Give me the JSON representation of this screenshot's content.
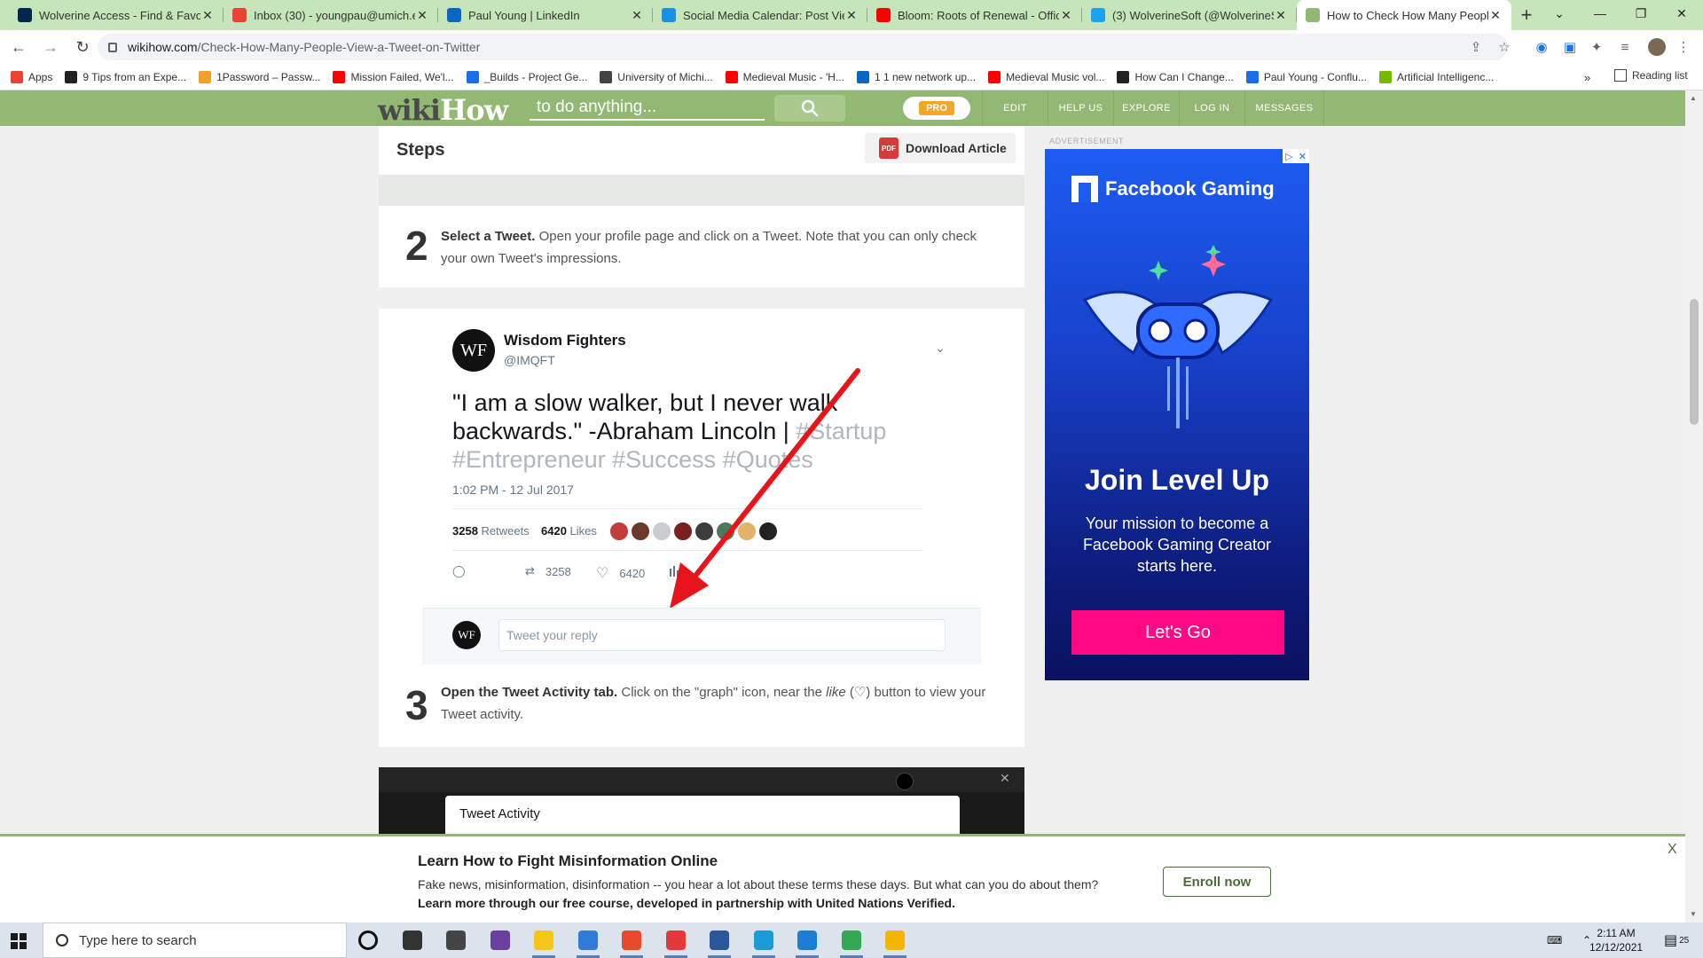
{
  "browser": {
    "tabs": [
      {
        "title": "Wolverine Access - Find & Favor",
        "icon": "umich-icon",
        "color": "#00274c",
        "active": false
      },
      {
        "title": "Inbox (30) - youngpau@umich.e",
        "icon": "gmail-icon",
        "color": "#ea4335",
        "active": false
      },
      {
        "title": "Paul Young | LinkedIn",
        "icon": "linkedin-icon",
        "color": "#0a66c2",
        "active": false
      },
      {
        "title": "Social Media Calendar: Post Vie",
        "icon": "calendar-icon",
        "color": "#1b8fe0",
        "active": false
      },
      {
        "title": "Bloom: Roots of Renewal - Offic",
        "icon": "youtube-icon",
        "color": "#ff0000",
        "active": false
      },
      {
        "title": "(3) WolverineSoft (@WolverineS",
        "icon": "twitter-icon",
        "color": "#1da1f2",
        "active": false
      },
      {
        "title": "How to Check How Many Peopl",
        "icon": "wikihow-icon",
        "color": "#93b874",
        "active": true
      }
    ],
    "new_tab_label": "+",
    "url_domain": "wikihow.com",
    "url_path": "/Check-How-Many-People-View-a-Tweet-on-Twitter",
    "bookmarks": [
      {
        "label": "Apps",
        "color": "#ea4335"
      },
      {
        "label": "9 Tips from an Expe...",
        "color": "#222222"
      },
      {
        "label": "1Password – Passw...",
        "color": "#f0a02b"
      },
      {
        "label": "Mission Failed, We'l...",
        "color": "#ff0000"
      },
      {
        "label": "_Builds - Project Ge...",
        "color": "#1b6ee5"
      },
      {
        "label": "University of Michi...",
        "color": "#444444"
      },
      {
        "label": "Medieval Music - 'H...",
        "color": "#ff0000"
      },
      {
        "label": "1 1 new network up...",
        "color": "#0a66c2"
      },
      {
        "label": "Medieval Music vol...",
        "color": "#ff0000"
      },
      {
        "label": "How Can I Change...",
        "color": "#222222"
      },
      {
        "label": "Paul Young - Conflu...",
        "color": "#1b6ee5"
      },
      {
        "label": "Artificial Intelligenc...",
        "color": "#76b900"
      }
    ],
    "bookmarks_more": "»",
    "reading_list": "Reading list"
  },
  "wikihow": {
    "logo_wiki": "wiki",
    "logo_how": "How",
    "search_placeholder": "to do anything...",
    "pro_label": "PRO",
    "nav": [
      "EDIT",
      "HELP US",
      "EXPLORE",
      "LOG IN",
      "MESSAGES"
    ]
  },
  "article": {
    "steps_title": "Steps",
    "download_label": "Download Article",
    "pdf_badge": "PDF",
    "step2": {
      "number": "2",
      "bold": "Select a Tweet.",
      "text": " Open your profile page and click on a Tweet. Note that you can only check your own Tweet's impressions."
    },
    "step3": {
      "number": "3",
      "bold": "Open the Tweet Activity tab.",
      "text_a": " Click on the \"graph\" icon, near the ",
      "text_like": "like",
      "text_b": " (♡) button to view your Tweet activity."
    }
  },
  "tweet": {
    "avatar": "WF",
    "name": "Wisdom Fighters",
    "handle": "@IMQFT",
    "body_line1": "\"I am a slow walker, but I never walk",
    "body_line2": "backwards.\" -Abraham Lincoln | ",
    "tag1": "#Startup",
    "tags_line3": "#Entrepreneur #Success #Quotes",
    "time": "1:02 PM - 12 Jul 2017",
    "retweets": "3258",
    "retweets_label": "Retweets",
    "likes": "6420",
    "likes_label": "Likes",
    "action_retweets": "3258",
    "action_likes": "6420",
    "reply_avatar": "WF",
    "reply_placeholder": "Tweet your reply",
    "liker_colors": [
      "#c43b3b",
      "#6b3a2a",
      "#c9cdd2",
      "#7a2020",
      "#3d3d3d",
      "#4a7a5a",
      "#e2b46a",
      "#222222"
    ]
  },
  "preview": {
    "modal_title": "Tweet Activity",
    "close": "✕"
  },
  "ad": {
    "label": "ADVERTISEMENT",
    "brand": "Facebook Gaming",
    "headline": "Join Level Up",
    "sub": "Your mission to become a Facebook Gaming Creator starts here.",
    "cta": "Let's Go"
  },
  "banner": {
    "title": "Learn How to Fight Misinformation Online",
    "text1": "Fake news, misinformation, disinformation -- you hear a lot about these terms these days. But what can you do about them?",
    "text2": "Learn more through our free course, developed in partnership with United Nations Verified.",
    "enroll": "Enroll now",
    "close": "X"
  },
  "taskbar": {
    "search_placeholder": "Type here to search",
    "time": "2:11 AM",
    "date": "12/12/2021",
    "notif_count": "25",
    "apps": [
      {
        "name": "cortana-icon",
        "color": "#111111"
      },
      {
        "name": "taskview-icon",
        "color": "#333333"
      },
      {
        "name": "store-icon",
        "color": "#444444"
      },
      {
        "name": "podcast-icon",
        "color": "#6b3fa0"
      },
      {
        "name": "file-explorer-icon",
        "color": "#f5c518"
      },
      {
        "name": "mail-icon",
        "color": "#2f7bd6"
      },
      {
        "name": "office-icon",
        "color": "#e8492a"
      },
      {
        "name": "discord-icon",
        "color": "#e5383b"
      },
      {
        "name": "word-icon",
        "color": "#2b579a"
      },
      {
        "name": "edge-icon",
        "color": "#1b9bd7"
      },
      {
        "name": "vscode-icon",
        "color": "#1a7fd4"
      },
      {
        "name": "chrome-icon",
        "color": "#34a853"
      },
      {
        "name": "chrome-canary-icon",
        "color": "#f4b400"
      }
    ]
  }
}
